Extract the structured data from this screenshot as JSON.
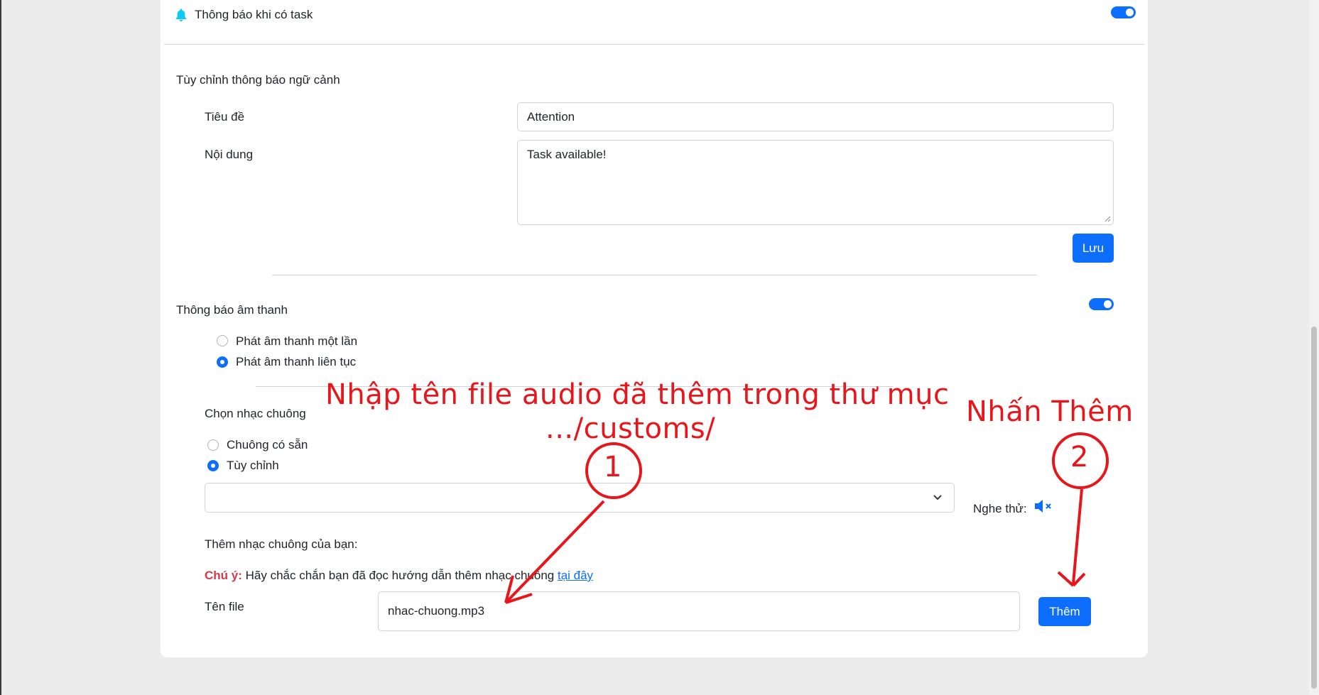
{
  "notify_task": {
    "label": "Thông báo khi có task",
    "enabled": true
  },
  "context_notify": {
    "section_title": "Tùy chỉnh thông báo ngữ cảnh",
    "title_label": "Tiêu đề",
    "title_value": "Attention",
    "content_label": "Nội dung",
    "content_value": "Task available!",
    "save_label": "Lưu"
  },
  "sound_notify": {
    "section_title": "Thông báo âm thanh",
    "enabled": true,
    "options": [
      {
        "label": "Phát âm thanh một lần",
        "selected": false
      },
      {
        "label": "Phát âm thanh liên tục",
        "selected": true
      }
    ]
  },
  "ringtone": {
    "section_title": "Chọn nhạc chuông",
    "options": [
      {
        "label": "Chuông có sẵn",
        "selected": false
      },
      {
        "label": "Tùy chỉnh",
        "selected": true
      }
    ],
    "select_value": "",
    "preview_label": "Nghe thử:",
    "preview_icon": "volume-mute-icon"
  },
  "add_ringtone": {
    "section_title": "Thêm nhạc chuông của bạn:",
    "note_prefix": "Chú ý:",
    "note_text": "Hãy chắc chắn bạn đã đọc hướng dẫn thêm nhạc chuông",
    "note_link": "tại đây",
    "file_label": "Tên file",
    "file_value": "nhac-chuong.mp3",
    "add_label": "Thêm"
  },
  "annotations": {
    "instruction_line1": "Nhập tên file audio đã thêm trong thư mục",
    "instruction_line2": ".../customs/",
    "step1": "1",
    "step2_text": "Nhấn Thêm",
    "step2": "2"
  },
  "colors": {
    "primary": "#0d6efd",
    "annotation_red": "#e8161b",
    "warning_red": "#dc3545",
    "bell": "#0dcaf0"
  }
}
